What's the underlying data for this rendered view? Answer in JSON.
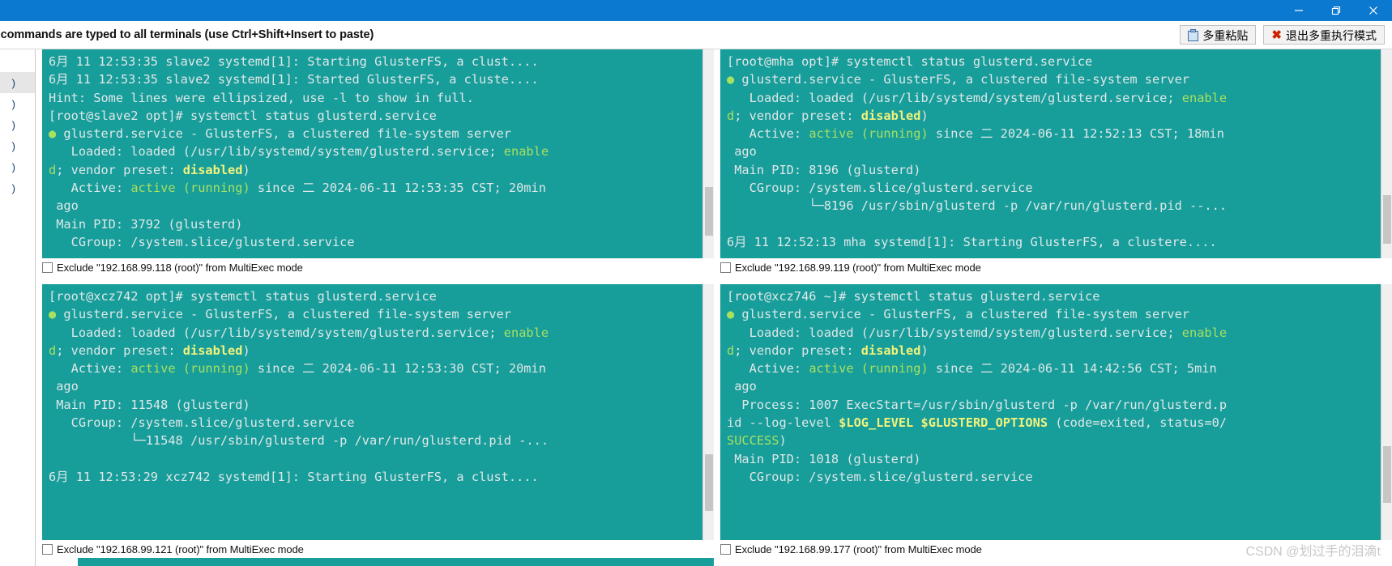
{
  "window": {
    "minimize_label": "minimize",
    "restore_label": "restore",
    "close_label": "close"
  },
  "notice": {
    "text": ": commands are typed to all terminals (use Ctrl+Shift+Insert to paste)"
  },
  "toolbar": {
    "multi_paste_label": "多重粘贴",
    "exit_multiexec_label": "退出多重执行模式",
    "clipboard_icon": "clipboard-icon",
    "close_icon": "red-x-icon"
  },
  "sidebar": {
    "items": [
      {
        "label": ")"
      },
      {
        "label": ")"
      },
      {
        "label": ")"
      },
      {
        "label": ")"
      },
      {
        "label": ")"
      },
      {
        "label": ")"
      }
    ]
  },
  "panels": [
    {
      "id": "top-left",
      "host": "slave2",
      "checkbox_label": "Exclude \"192.168.99.118 (root)\" from MultiExec mode",
      "checked": false,
      "lines": [
        [
          {
            "t": "6月 11 12:53:35 slave2 systemd[1]: Starting GlusterFS, a clust....",
            "c": ""
          }
        ],
        [
          {
            "t": "6月 11 12:53:35 slave2 systemd[1]: Started GlusterFS, a cluste....",
            "c": ""
          }
        ],
        [
          {
            "t": "Hint: Some lines were ellipsized, use -l to show in full.",
            "c": ""
          }
        ],
        [
          {
            "t": "[root@slave2 opt]# systemctl status glusterd.service",
            "c": ""
          }
        ],
        [
          {
            "t": "● ",
            "c": "dot"
          },
          {
            "t": "glusterd.service - GlusterFS, a clustered file-system server",
            "c": ""
          }
        ],
        [
          {
            "t": "   Loaded: loaded (/usr/lib/systemd/system/glusterd.service; ",
            "c": ""
          },
          {
            "t": "enable",
            "c": "green"
          }
        ],
        [
          {
            "t": "d",
            "c": "green"
          },
          {
            "t": "; vendor preset: ",
            "c": ""
          },
          {
            "t": "disabled",
            "c": "yellow"
          },
          {
            "t": ")",
            "c": ""
          }
        ],
        [
          {
            "t": "   Active: ",
            "c": ""
          },
          {
            "t": "active (running)",
            "c": "green"
          },
          {
            "t": " since 二 2024-06-11 12:53:35 CST; 20min",
            "c": ""
          }
        ],
        [
          {
            "t": " ago",
            "c": ""
          }
        ],
        [
          {
            "t": " Main PID: 3792 (glusterd)",
            "c": ""
          }
        ],
        [
          {
            "t": "   CGroup: /system.slice/glusterd.service",
            "c": ""
          }
        ]
      ]
    },
    {
      "id": "top-right",
      "host": "mha",
      "checkbox_label": "Exclude \"192.168.99.119 (root)\" from MultiExec mode",
      "checked": false,
      "lines": [
        [
          {
            "t": "[root@mha opt]# systemctl status glusterd.service",
            "c": ""
          }
        ],
        [
          {
            "t": "● ",
            "c": "dot"
          },
          {
            "t": "glusterd.service - GlusterFS, a clustered file-system server",
            "c": ""
          }
        ],
        [
          {
            "t": "   Loaded: loaded (/usr/lib/systemd/system/glusterd.service; ",
            "c": ""
          },
          {
            "t": "enable",
            "c": "green"
          }
        ],
        [
          {
            "t": "d",
            "c": "green"
          },
          {
            "t": "; vendor preset: ",
            "c": ""
          },
          {
            "t": "disabled",
            "c": "yellow"
          },
          {
            "t": ")",
            "c": ""
          }
        ],
        [
          {
            "t": "   Active: ",
            "c": ""
          },
          {
            "t": "active (running)",
            "c": "green"
          },
          {
            "t": " since 二 2024-06-11 12:52:13 CST; 18min",
            "c": ""
          }
        ],
        [
          {
            "t": " ago",
            "c": ""
          }
        ],
        [
          {
            "t": " Main PID: 8196 (glusterd)",
            "c": ""
          }
        ],
        [
          {
            "t": "   CGroup: /system.slice/glusterd.service",
            "c": ""
          }
        ],
        [
          {
            "t": "           └─8196 /usr/sbin/glusterd -p /var/run/glusterd.pid --...",
            "c": ""
          }
        ],
        [
          {
            "t": "",
            "c": ""
          }
        ],
        [
          {
            "t": "6月 11 12:52:13 mha systemd[1]: Starting GlusterFS, a clustere....",
            "c": ""
          }
        ]
      ]
    },
    {
      "id": "bottom-left",
      "host": "xcz742",
      "checkbox_label": "Exclude \"192.168.99.121 (root)\" from MultiExec mode",
      "checked": false,
      "lines": [
        [
          {
            "t": "[root@xcz742 opt]# systemctl status glusterd.service",
            "c": ""
          }
        ],
        [
          {
            "t": "● ",
            "c": "dot"
          },
          {
            "t": "glusterd.service - GlusterFS, a clustered file-system server",
            "c": ""
          }
        ],
        [
          {
            "t": "   Loaded: loaded (/usr/lib/systemd/system/glusterd.service; ",
            "c": ""
          },
          {
            "t": "enable",
            "c": "green"
          }
        ],
        [
          {
            "t": "d",
            "c": "green"
          },
          {
            "t": "; vendor preset: ",
            "c": ""
          },
          {
            "t": "disabled",
            "c": "yellow"
          },
          {
            "t": ")",
            "c": ""
          }
        ],
        [
          {
            "t": "   Active: ",
            "c": ""
          },
          {
            "t": "active (running)",
            "c": "green"
          },
          {
            "t": " since 二 2024-06-11 12:53:30 CST; 20min",
            "c": ""
          }
        ],
        [
          {
            "t": " ago",
            "c": ""
          }
        ],
        [
          {
            "t": " Main PID: 11548 (glusterd)",
            "c": ""
          }
        ],
        [
          {
            "t": "   CGroup: /system.slice/glusterd.service",
            "c": ""
          }
        ],
        [
          {
            "t": "           └─11548 /usr/sbin/glusterd -p /var/run/glusterd.pid -...",
            "c": ""
          }
        ],
        [
          {
            "t": "",
            "c": ""
          }
        ],
        [
          {
            "t": "6月 11 12:53:29 xcz742 systemd[1]: Starting GlusterFS, a clust....",
            "c": ""
          }
        ]
      ]
    },
    {
      "id": "bottom-right",
      "host": "xcz746",
      "checkbox_label": "Exclude \"192.168.99.177 (root)\" from MultiExec mode",
      "checked": false,
      "lines": [
        [
          {
            "t": "[root@xcz746 ~]# systemctl status glusterd.service",
            "c": ""
          }
        ],
        [
          {
            "t": "● ",
            "c": "dot"
          },
          {
            "t": "glusterd.service - GlusterFS, a clustered file-system server",
            "c": ""
          }
        ],
        [
          {
            "t": "   Loaded: loaded (/usr/lib/systemd/system/glusterd.service; ",
            "c": ""
          },
          {
            "t": "enable",
            "c": "green"
          }
        ],
        [
          {
            "t": "d",
            "c": "green"
          },
          {
            "t": "; vendor preset: ",
            "c": ""
          },
          {
            "t": "disabled",
            "c": "yellow"
          },
          {
            "t": ")",
            "c": ""
          }
        ],
        [
          {
            "t": "   Active: ",
            "c": ""
          },
          {
            "t": "active (running)",
            "c": "green"
          },
          {
            "t": " since 二 2024-06-11 14:42:56 CST; 5min",
            "c": ""
          }
        ],
        [
          {
            "t": " ago",
            "c": ""
          }
        ],
        [
          {
            "t": "  Process: 1007 ExecStart=/usr/sbin/glusterd -p /var/run/glusterd.p",
            "c": ""
          }
        ],
        [
          {
            "t": "id --log-level ",
            "c": ""
          },
          {
            "t": "$LOG_LEVEL",
            "c": "yellow"
          },
          {
            "t": " ",
            "c": ""
          },
          {
            "t": "$GLUSTERD_OPTIONS",
            "c": "yellow"
          },
          {
            "t": " (code=exited, status=0/",
            "c": ""
          }
        ],
        [
          {
            "t": "SUCCESS",
            "c": "green"
          },
          {
            "t": ")",
            "c": ""
          }
        ],
        [
          {
            "t": " Main PID: 1018 (glusterd)",
            "c": ""
          }
        ],
        [
          {
            "t": "   CGroup: /system.slice/glusterd.service",
            "c": ""
          }
        ]
      ]
    }
  ],
  "watermark": {
    "text": "CSDN @划过手的泪滴t"
  },
  "colors": {
    "titlebar": "#0c79d0",
    "terminal_bg": "#179d9a",
    "terminal_fg": "#dfe8e8",
    "accent_green": "#a8e05f",
    "accent_yellow": "#f2f27a",
    "accent_red": "#cc2200"
  }
}
